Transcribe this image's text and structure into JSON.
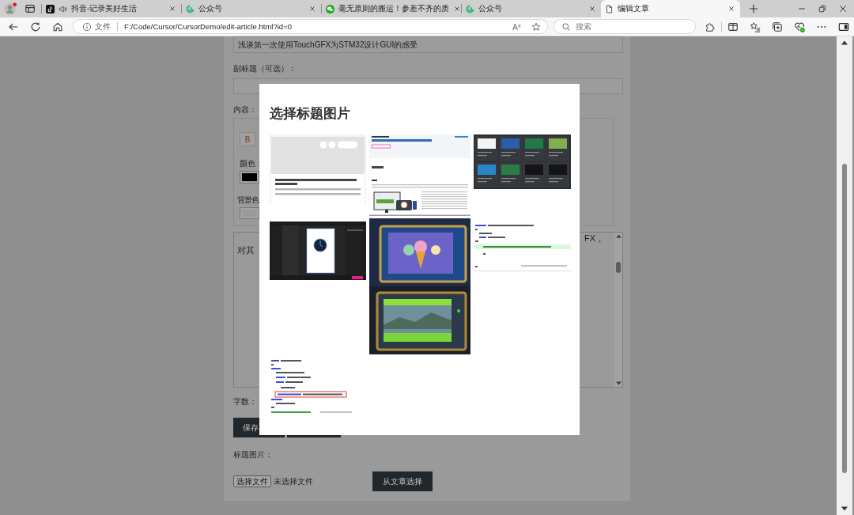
{
  "browser": {
    "tabs": [
      {
        "title": "抖音-记录美好生活",
        "kind": "tiktok",
        "playing_audio": true,
        "selected": false
      },
      {
        "title": "公众号",
        "kind": "ring",
        "playing_audio": false,
        "selected": false
      },
      {
        "title": "毫无原则的搬运！参差不齐的质",
        "kind": "chat",
        "playing_audio": false,
        "selected": false
      },
      {
        "title": "公众号",
        "kind": "ring",
        "playing_audio": false,
        "selected": false
      },
      {
        "title": "编辑文章",
        "kind": "page",
        "playing_audio": false,
        "selected": true
      }
    ],
    "address_bar": {
      "site_info": "文件",
      "url": "F:/Code/Cursor/CursorDemo/edit-article.html?id=0"
    },
    "search_box": {
      "placeholder": "搜索"
    }
  },
  "page": {
    "title_field": {
      "value": "浅谈第一次使用TouchGFX为STM32设计GUI的感受"
    },
    "subtitle_label": "副标题（可选）：",
    "content_label": "内容：",
    "editor": {
      "bold_button": "B",
      "color_label": "颜色：",
      "background_label": "背景色"
    },
    "content_field": {
      "line_1_end": "FX，",
      "line_2_start": "对其"
    },
    "word_count_label": "字数：",
    "save_button": "保存",
    "title_image_label": "标题图片：",
    "file_button": "选择文件",
    "file_status": "未选择文件",
    "pick_from_articles_button": "从文章选择"
  },
  "dialog": {
    "title": "选择标题图片",
    "images": [
      {
        "kind": "article_card"
      },
      {
        "kind": "web_page"
      },
      {
        "kind": "board_gallery"
      },
      {
        "kind": "editor_window"
      },
      {
        "kind": "board_photo"
      },
      {
        "kind": "code_snippet"
      },
      {
        "kind": "code_boxed"
      }
    ]
  }
}
